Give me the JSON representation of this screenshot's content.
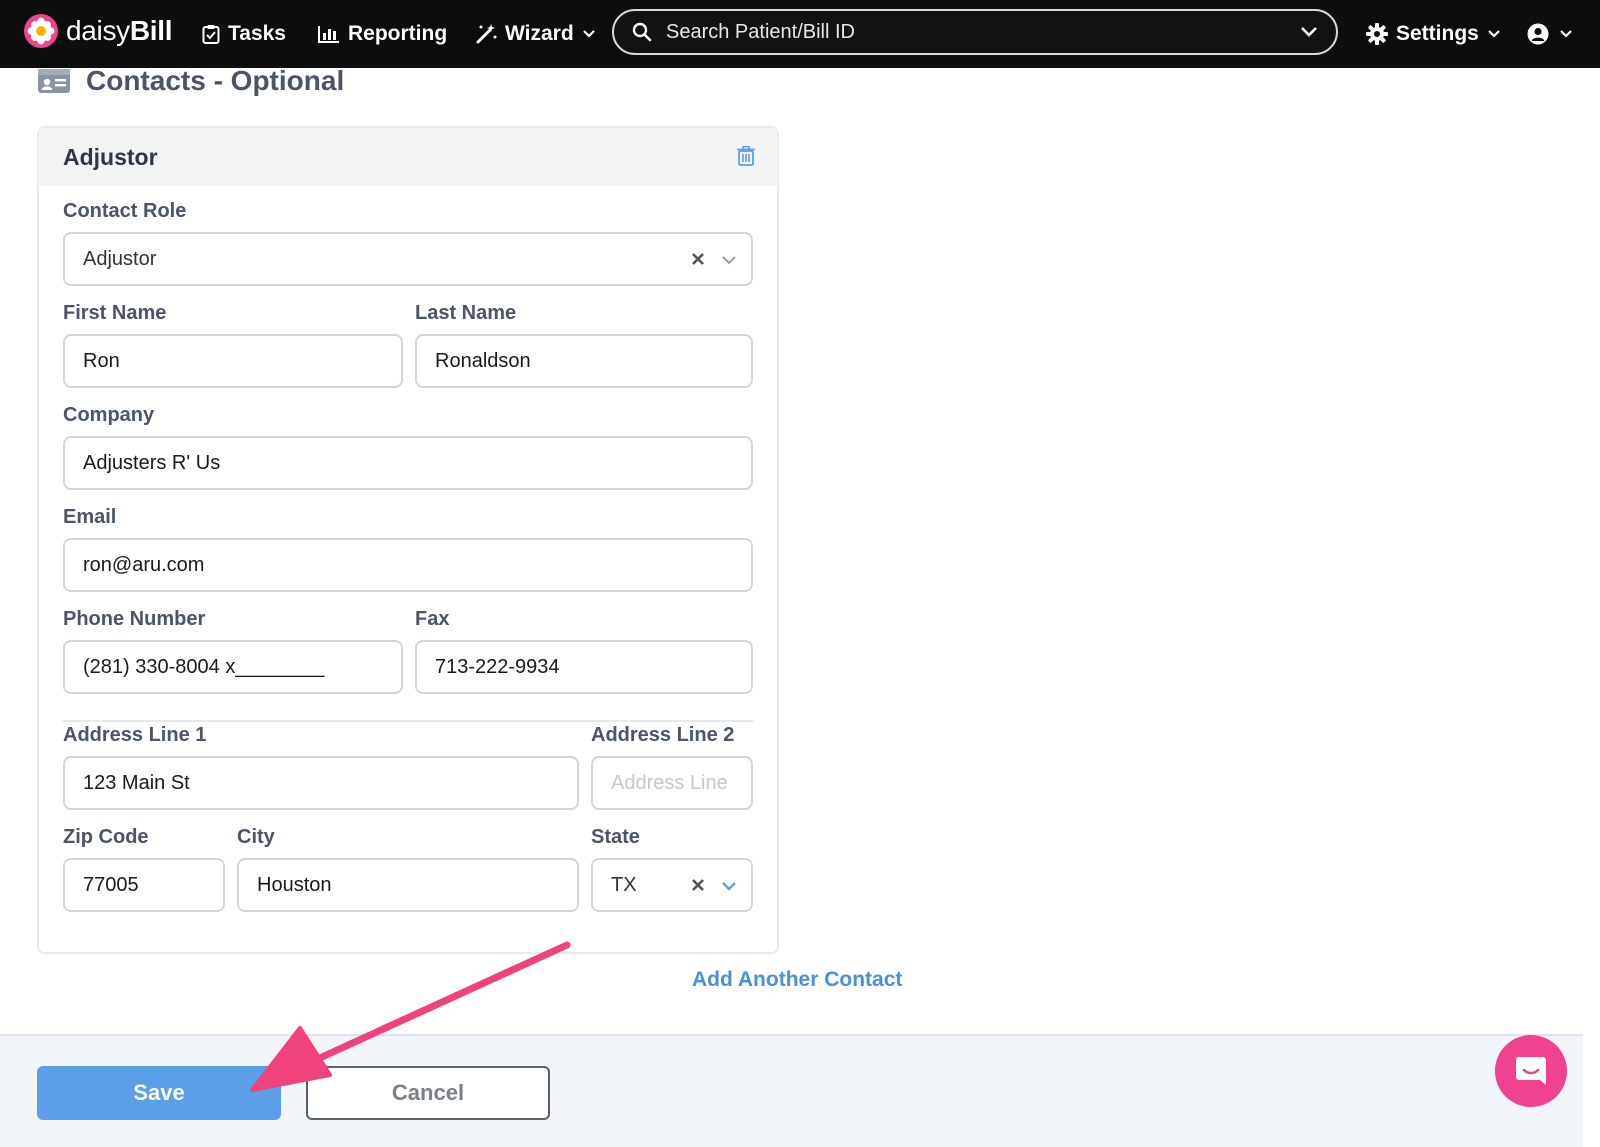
{
  "navbar": {
    "brand_light": "daisy",
    "brand_bold": "Bill",
    "tasks": "Tasks",
    "reporting": "Reporting",
    "wizard": "Wizard",
    "search_placeholder": "Search Patient/Bill ID",
    "settings": "Settings"
  },
  "section": {
    "title": "Contacts - Optional"
  },
  "card": {
    "title": "Adjustor",
    "contact_role": {
      "label": "Contact Role",
      "value": "Adjustor"
    },
    "first_name": {
      "label": "First Name",
      "value": "Ron"
    },
    "last_name": {
      "label": "Last Name",
      "value": "Ronaldson"
    },
    "company": {
      "label": "Company",
      "value": "Adjusters R' Us"
    },
    "email": {
      "label": "Email",
      "value": "ron@aru.com"
    },
    "phone": {
      "label": "Phone Number",
      "value": "(281) 330-8004 x________"
    },
    "fax": {
      "label": "Fax",
      "value": "713-222-9934"
    },
    "address1": {
      "label": "Address Line 1",
      "value": "123 Main St"
    },
    "address2": {
      "label": "Address Line 2",
      "placeholder": "Address Line"
    },
    "zip": {
      "label": "Zip Code",
      "value": "77005"
    },
    "city": {
      "label": "City",
      "value": "Houston"
    },
    "state": {
      "label": "State",
      "value": "TX"
    }
  },
  "add_contact": "Add Another Contact",
  "footer": {
    "save": "Save",
    "cancel": "Cancel"
  },
  "colors": {
    "navbar_bg": "#0d0d0d",
    "primary": "#5b9fe8",
    "link": "#4a90d9",
    "accent_pink": "#f0428f",
    "arrow": "#f0427d"
  },
  "icons": [
    "daisy-logo-icon",
    "clipboard-check-icon",
    "bar-chart-icon",
    "magic-wand-icon",
    "search-icon",
    "gear-icon",
    "user-circle-icon",
    "id-card-icon",
    "trash-icon",
    "clear-x-icon",
    "chevron-down-icon",
    "chat-icon",
    "annotation-arrow"
  ]
}
